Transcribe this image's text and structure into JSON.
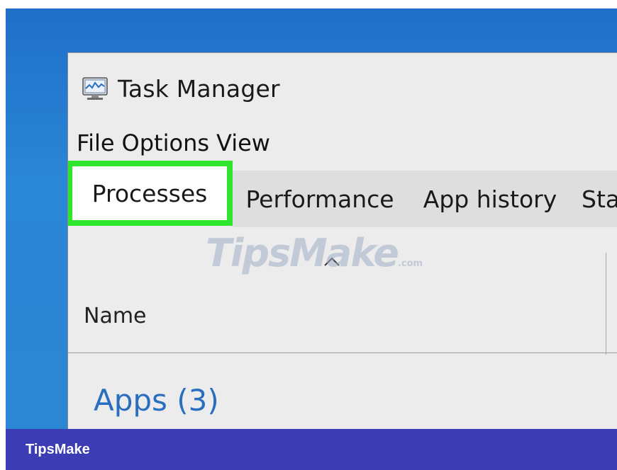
{
  "window": {
    "title": "Task Manager",
    "icon": "task-manager-icon"
  },
  "menu": {
    "items": [
      "File",
      "Options",
      "View"
    ]
  },
  "tabs": [
    {
      "label": "Processes",
      "active": true
    },
    {
      "label": "Performance",
      "active": false
    },
    {
      "label": "App history",
      "active": false
    },
    {
      "label": "Sta",
      "active": false
    }
  ],
  "table": {
    "column_name": "Name",
    "sort_indicator": "chevron-up-icon"
  },
  "groups": {
    "apps_label": "Apps (3)"
  },
  "watermark": {
    "main": "TipsMake",
    "suffix": ".com"
  },
  "footer": {
    "brand": "TipsMake"
  },
  "colors": {
    "highlight": "#2ee62e",
    "footer": "#3c3cb4",
    "desktop": "#2a86d6",
    "group_label": "#2a6fbf"
  }
}
